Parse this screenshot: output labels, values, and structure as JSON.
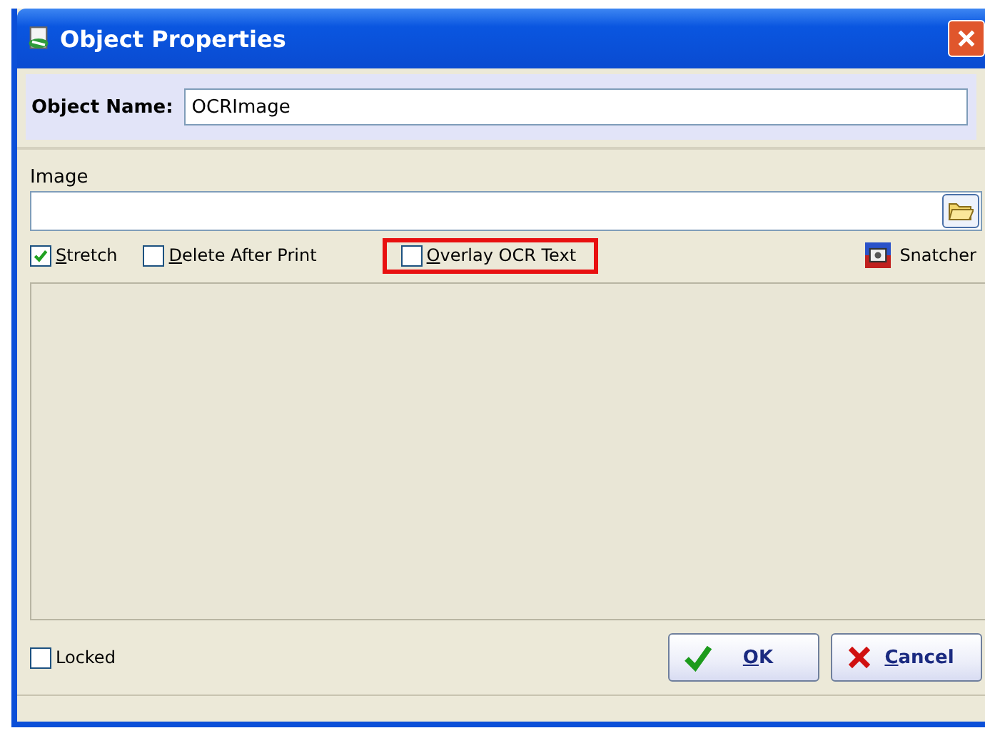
{
  "window": {
    "title": "Object Properties"
  },
  "object_name": {
    "label": "Object Name:",
    "value": "OCRImage"
  },
  "image": {
    "label": "Image"
  },
  "options": [
    {
      "label": "Stretch",
      "checked": true,
      "access_key": true,
      "highlighted": false
    },
    {
      "label": "Delete After Print",
      "checked": false,
      "access_key": true,
      "highlighted": false
    },
    {
      "label": "Overlay OCR Text",
      "checked": false,
      "access_key": true,
      "highlighted": true
    }
  ],
  "snatcher": {
    "label": "Snatcher"
  },
  "locked": {
    "label": "Locked",
    "checked": false
  },
  "buttons": [
    {
      "kind": "ok",
      "label": "OK"
    },
    {
      "kind": "cancel",
      "label": "Cancel"
    }
  ]
}
